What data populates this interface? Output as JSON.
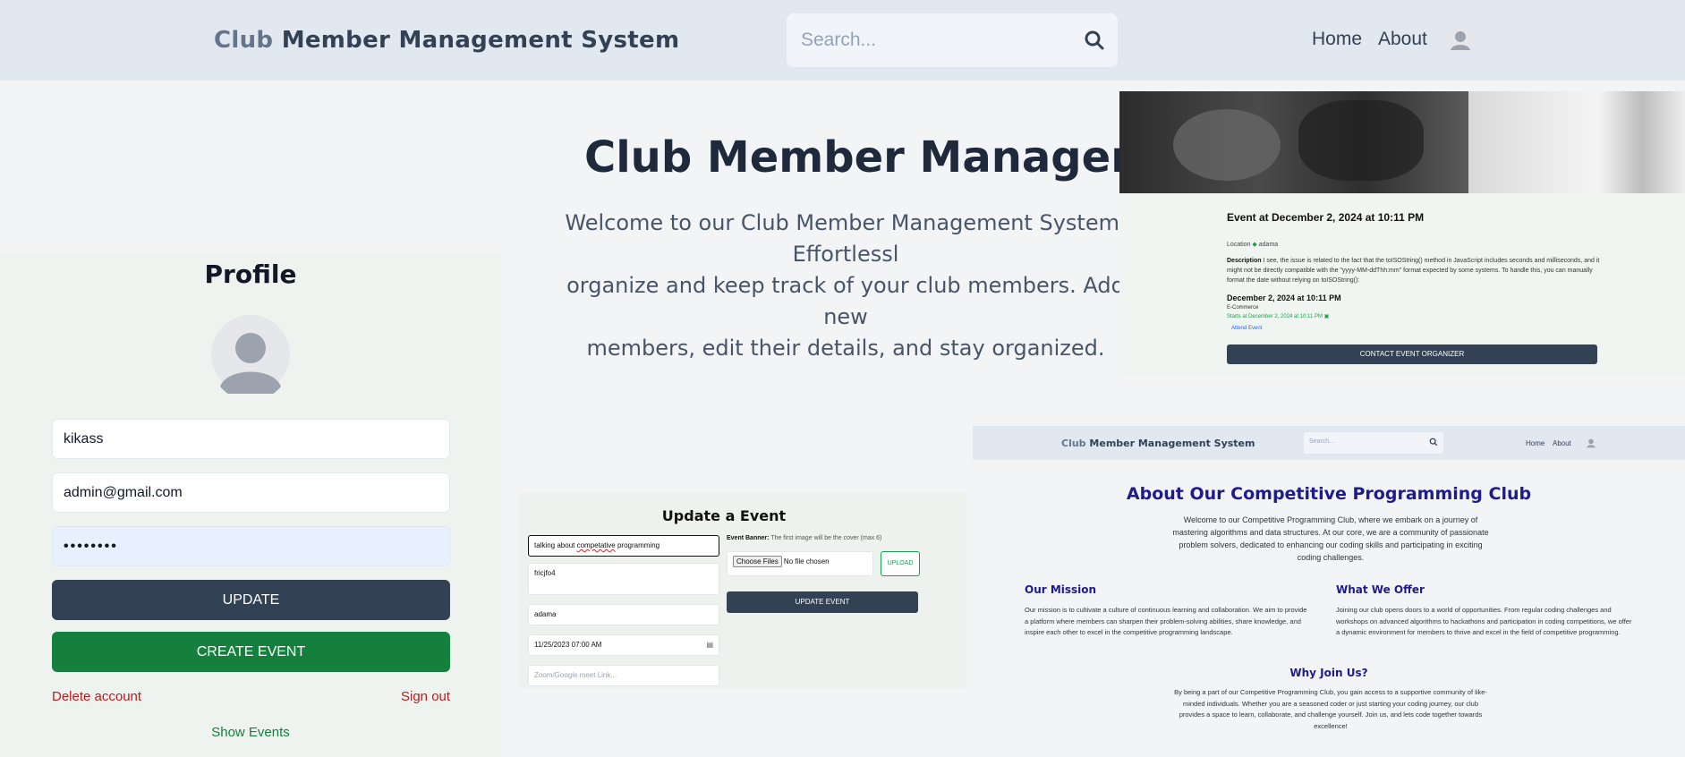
{
  "header": {
    "brand_word1": "Club",
    "brand_rest": "Member Management System",
    "search_placeholder": "Search...",
    "nav": {
      "home": "Home",
      "about": "About"
    },
    "icons": {
      "search": "search-icon",
      "user": "user-avatar-icon"
    }
  },
  "hero": {
    "title": "Club Member Management",
    "text": "Welcome to our Club Member Management System. Effortlessl\norganize and keep track of your club members. Add new\nmembers, edit their details, and stay organized."
  },
  "profile": {
    "title": "Profile",
    "username": "kikass",
    "email": "admin@gmail.com",
    "password_mask": "••••••••",
    "update_label": "UPDATE",
    "create_event_label": "CREATE EVENT",
    "delete_account": "Delete account",
    "sign_out": "Sign out",
    "show_events": "Show Events"
  },
  "event_card": {
    "title": "Event at December 2, 2024 at 10:11 PM",
    "location_label": "Location",
    "location_value": "adama",
    "description_label": "Description",
    "description_text": "I see, the issue is related to the fact that the toISOString() method in JavaScript includes seconds and milliseconds, and it might not be directly compatible with the \"yyyy-MM-ddThh:mm\" format expected by some systems. To handle this, you can manually format the date without relying on toISOString():",
    "date": "December 2, 2024 at 10:11 PM",
    "category": "E-Commerce",
    "starts": "Starts at December 2, 2024 at 10:11 PM",
    "attend": "Attend Event",
    "contact_button": "CONTACT EVENT ORGANIZER"
  },
  "update_event": {
    "title": "Update a Event",
    "field_title_pre": "talking about ",
    "field_title_misspelled": "competative",
    "field_title_post": " programming",
    "field_description": "fricjfo4",
    "field_location": "adama",
    "field_datetime": "11/25/2023 07:00 AM",
    "field_link_placeholder": "Zoom/Google meet Link...",
    "banner_label": "Event Banner:",
    "banner_hint": "The first image will be the cover (max 6)",
    "choose_files": "Choose Files",
    "no_file": "No file chosen",
    "upload_label": "UPLOAD",
    "update_button": "UPDATE EVENT"
  },
  "about_page": {
    "brand_word1": "Club",
    "brand_rest": "Member Management System",
    "search_placeholder": "Search...",
    "nav_home": "Home",
    "nav_about": "About",
    "title": "About Our Competitive Programming Club",
    "intro": "Welcome to our Competitive Programming Club, where we embark on a journey of mastering algorithms and data structures. At our core, we are a community of passionate problem solvers, dedicated to enhancing our coding skills and participating in exciting coding challenges.",
    "mission_heading": "Our Mission",
    "mission_text": "Our mission is to cultivate a culture of continuous learning and collaboration. We aim to provide a platform where members can sharpen their problem-solving abilities, share knowledge, and inspire each other to excel in the competitive programming landscape.",
    "offer_heading": "What We Offer",
    "offer_text": "Joining our club opens doors to a world of opportunities. From regular coding challenges and workshops on advanced algorithms to hackathons and participation in coding competitions, we offer a dynamic environment for members to thrive and excel in the field of competitive programming.",
    "why_heading": "Why Join Us?",
    "why_text": "By being a part of our Competitive Programming Club, you gain access to a supportive community of like-minded individuals. Whether you are a seasoned coder or just starting your coding journey, our club provides a space to learn, collaborate, and challenge yourself. Join us, and lets code together towards excellence!"
  },
  "colors": {
    "navbar_bg": "#e2e8f0",
    "primary_dark": "#334155",
    "success_green": "#15803d",
    "danger_red": "#b91c1c",
    "about_heading": "#1e1b8f"
  }
}
